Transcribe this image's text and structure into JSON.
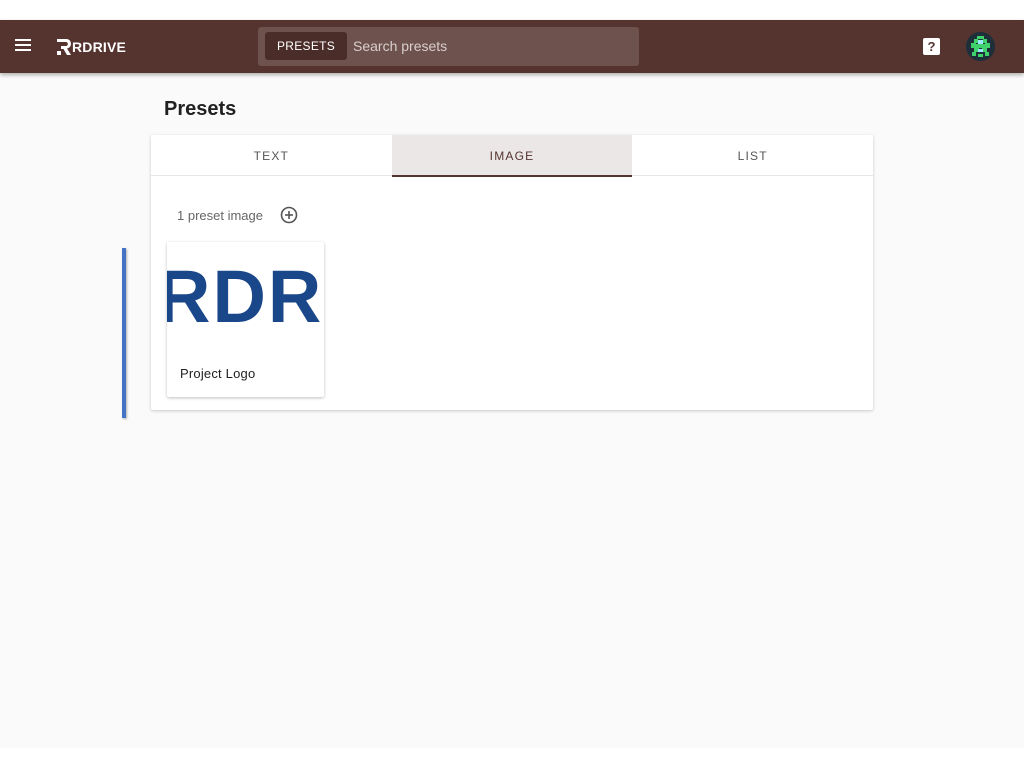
{
  "app": {
    "brand": "RDRIVE"
  },
  "search": {
    "chip_label": "PRESETS",
    "placeholder": "Search presets",
    "value": ""
  },
  "header": {
    "help_label": "?"
  },
  "page": {
    "title": "Presets"
  },
  "tabs": [
    {
      "label": "TEXT",
      "active": false
    },
    {
      "label": "IMAGE",
      "active": true
    },
    {
      "label": "LIST",
      "active": false
    }
  ],
  "content": {
    "count_text": "1 preset image",
    "items": [
      {
        "label": "Project Logo",
        "thumbnail_text": "RDR"
      }
    ]
  },
  "colors": {
    "appbar": "#553430",
    "tab_active_bg": "#ebe7e7",
    "logo_blue": "#1a4789",
    "handle_blue": "#4472c4"
  },
  "icons": {
    "menu": "hamburger-menu-icon",
    "help": "help-icon",
    "add": "add-circle-icon",
    "avatar": "pixel-avatar-icon"
  }
}
